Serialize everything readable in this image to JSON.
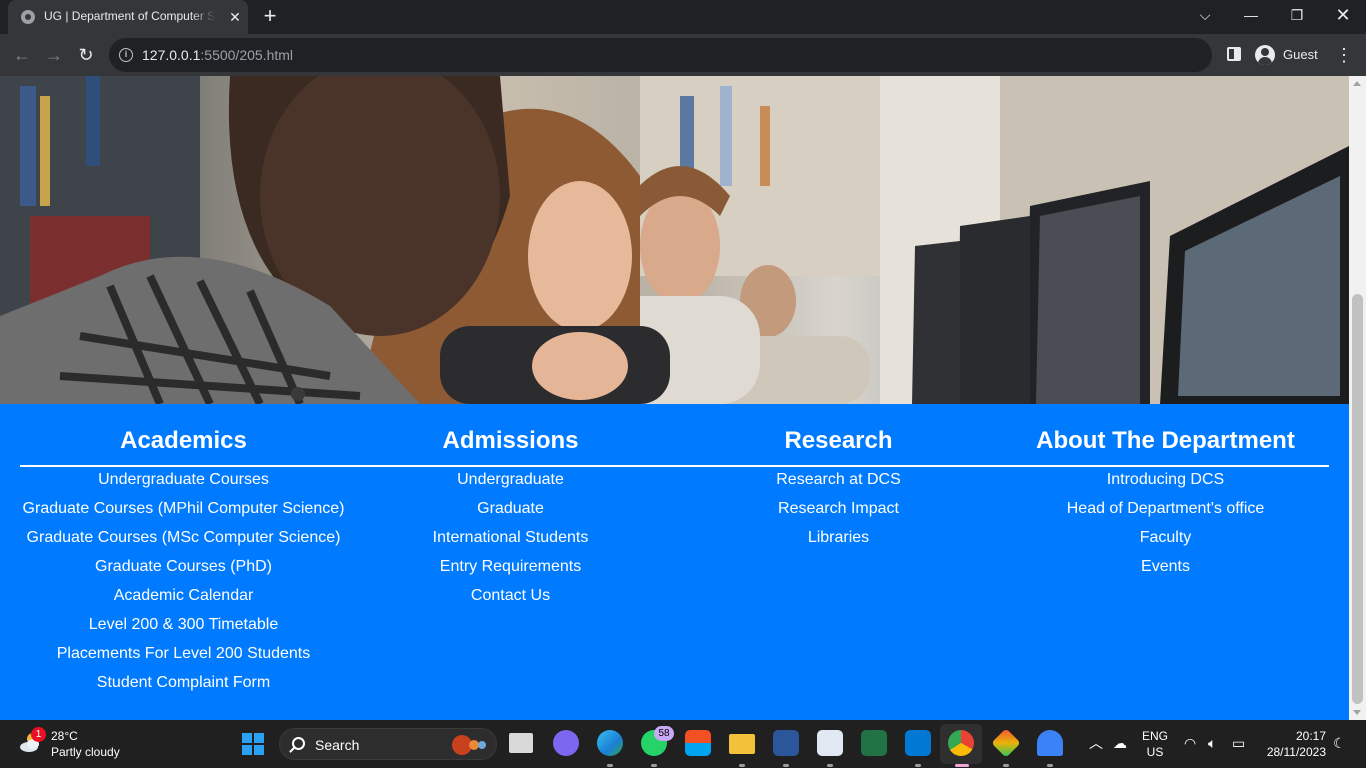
{
  "browser": {
    "tab_title": "UG | Department of Computer Science",
    "url_host": "127.0.0.1",
    "url_rest": ":5500/205.html",
    "profile_name": "Guest"
  },
  "footer": {
    "columns": [
      {
        "title": "Academics",
        "links": [
          "Undergraduate Courses",
          "Graduate Courses (MPhil Computer Science)",
          "Graduate Courses (MSc Computer Science)",
          "Graduate Courses (PhD)",
          "Academic Calendar",
          "Level 200 & 300 Timetable",
          "Placements For Level 200 Students",
          "Student Complaint Form"
        ]
      },
      {
        "title": "Admissions",
        "links": [
          "Undergraduate",
          "Graduate",
          "International Students",
          "Entry Requirements",
          "Contact Us"
        ]
      },
      {
        "title": "Research",
        "links": [
          "Research at DCS",
          "Research Impact",
          "Libraries"
        ]
      },
      {
        "title": "About The Department",
        "links": [
          "Introducing DCS",
          "Head of Department's office",
          "Faculty",
          "Events"
        ]
      }
    ]
  },
  "taskbar": {
    "weather_temp": "28°C",
    "weather_desc": "Partly cloudy",
    "weather_badge": "1",
    "search_label": "Search",
    "whatsapp_badge": "58",
    "lang": "ENG",
    "region": "US",
    "time": "20:17",
    "date": "28/11/2023"
  },
  "colors": {
    "footer_bg": "#007bff",
    "chrome_dark": "#202124",
    "chrome_toolbar": "#35363a",
    "taskbar_bg": "#202020"
  }
}
